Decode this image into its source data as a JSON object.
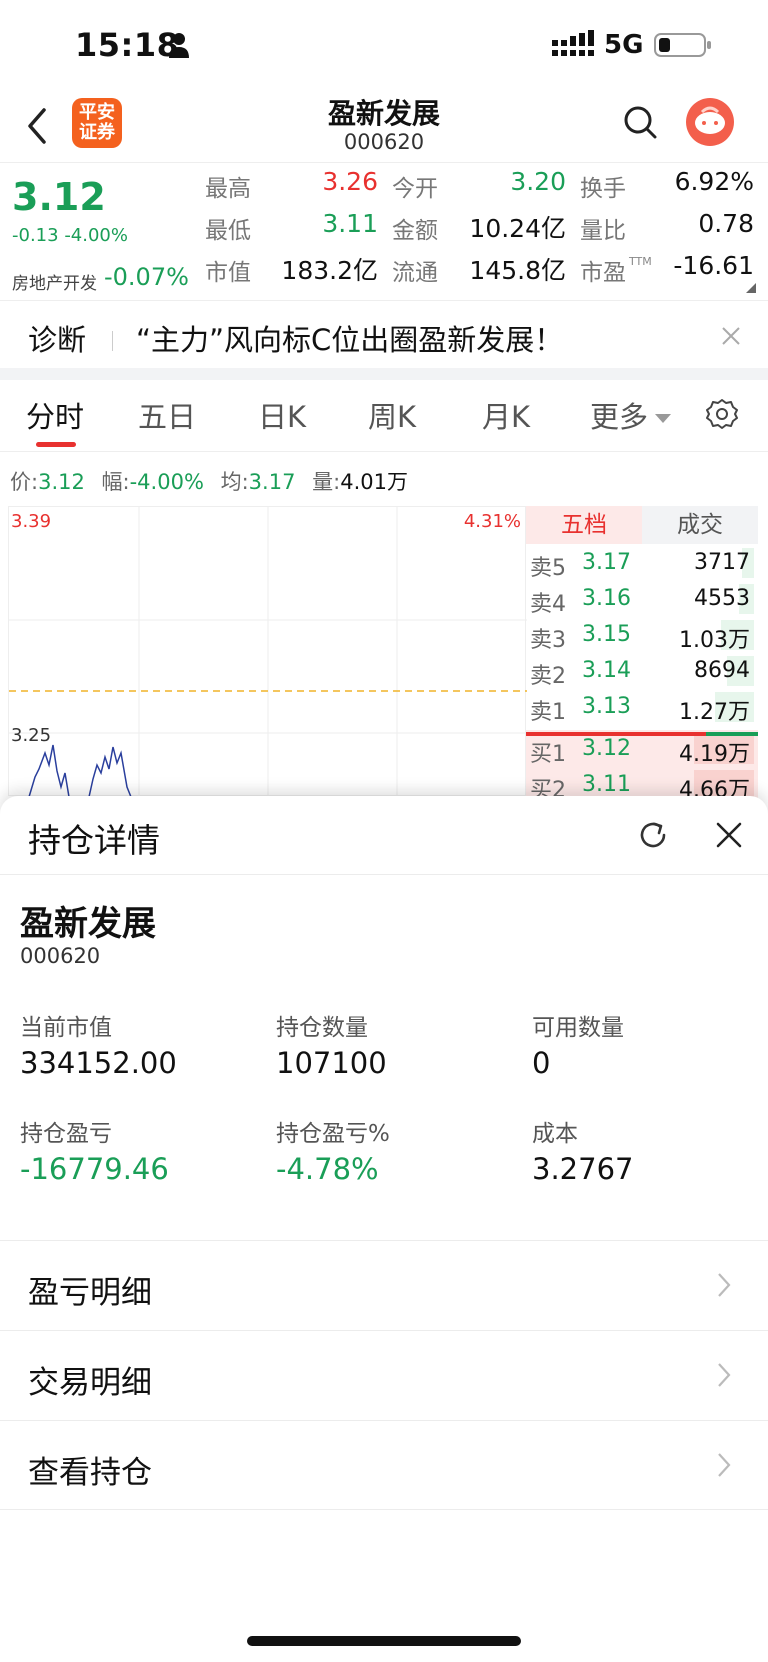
{
  "status_bar": {
    "time": "15:18",
    "network": "5G"
  },
  "header": {
    "title": "盈新发展",
    "code": "000620",
    "logo_text": "平安证券"
  },
  "quote": {
    "price": "3.12",
    "change": "-0.13",
    "change_pct": "-4.00%",
    "sector": "房地产开发",
    "sector_change": "-0.07%",
    "fields": [
      {
        "label": "最高",
        "value": "3.26"
      },
      {
        "label": "今开",
        "value": "3.20"
      },
      {
        "label": "换手",
        "value": "6.92%"
      },
      {
        "label": "最低",
        "value": "3.11"
      },
      {
        "label": "金额",
        "value": "10.24亿"
      },
      {
        "label": "量比",
        "value": "0.78"
      },
      {
        "label": "市值",
        "value": "183.2亿"
      },
      {
        "label": "流通",
        "value": "145.8亿"
      },
      {
        "label": "市盈",
        "value": "-16.61"
      }
    ],
    "ttm": "TTM"
  },
  "diagnosis": {
    "label": "诊断",
    "text": "“主力”风向标C位出圈盈新发展！"
  },
  "tabs": [
    "分时",
    "五日",
    "日K",
    "周K",
    "月K",
    "更多"
  ],
  "infoline": {
    "price_label": "价:",
    "price": "3.12",
    "amp_label": "幅:",
    "amp": "-4.00%",
    "avg_label": "均:",
    "avg": "3.17",
    "vol_label": "量:",
    "vol": "4.01万"
  },
  "chart": {
    "top_left": "3.39",
    "top_right": "4.31%",
    "mid_left": "3.25"
  },
  "orderbook": {
    "tabs": [
      "五档",
      "成交"
    ],
    "rows": [
      {
        "label": "卖5",
        "price": "3.17",
        "volume": "3717",
        "side": "sell",
        "depth": 0.2
      },
      {
        "label": "卖4",
        "price": "3.16",
        "volume": "4553",
        "side": "sell",
        "depth": 0.25
      },
      {
        "label": "卖3",
        "price": "3.15",
        "volume": "1.03万",
        "side": "sell",
        "depth": 0.55
      },
      {
        "label": "卖2",
        "price": "3.14",
        "volume": "8694",
        "side": "sell",
        "depth": 0.45
      },
      {
        "label": "卖1",
        "price": "3.13",
        "volume": "1.27万",
        "side": "sell",
        "depth": 0.65
      },
      {
        "label": "买1",
        "price": "3.12",
        "volume": "4.19万",
        "side": "buy",
        "depth": 1.0
      },
      {
        "label": "买2",
        "price": "3.11",
        "volume": "4.66万",
        "side": "buy",
        "depth": 1.0
      }
    ]
  },
  "holding": {
    "title": "持仓详情",
    "name": "盈新发展",
    "code": "000620",
    "fields": [
      {
        "label": "当前市值",
        "value": "334152.00",
        "tone": "normal"
      },
      {
        "label": "持仓数量",
        "value": "107100",
        "tone": "normal"
      },
      {
        "label": "可用数量",
        "value": "0",
        "tone": "normal"
      },
      {
        "label": "持仓盈亏",
        "value": "-16779.46",
        "tone": "green"
      },
      {
        "label": "持仓盈亏%",
        "value": "-4.78%",
        "tone": "green"
      },
      {
        "label": "成本",
        "value": "3.2767",
        "tone": "normal"
      }
    ],
    "menu": [
      "盈亏明细",
      "交易明细",
      "查看持仓"
    ]
  },
  "colors": {
    "up": "#e8312f",
    "down": "#1a9e57",
    "brand": "#f4611e"
  }
}
